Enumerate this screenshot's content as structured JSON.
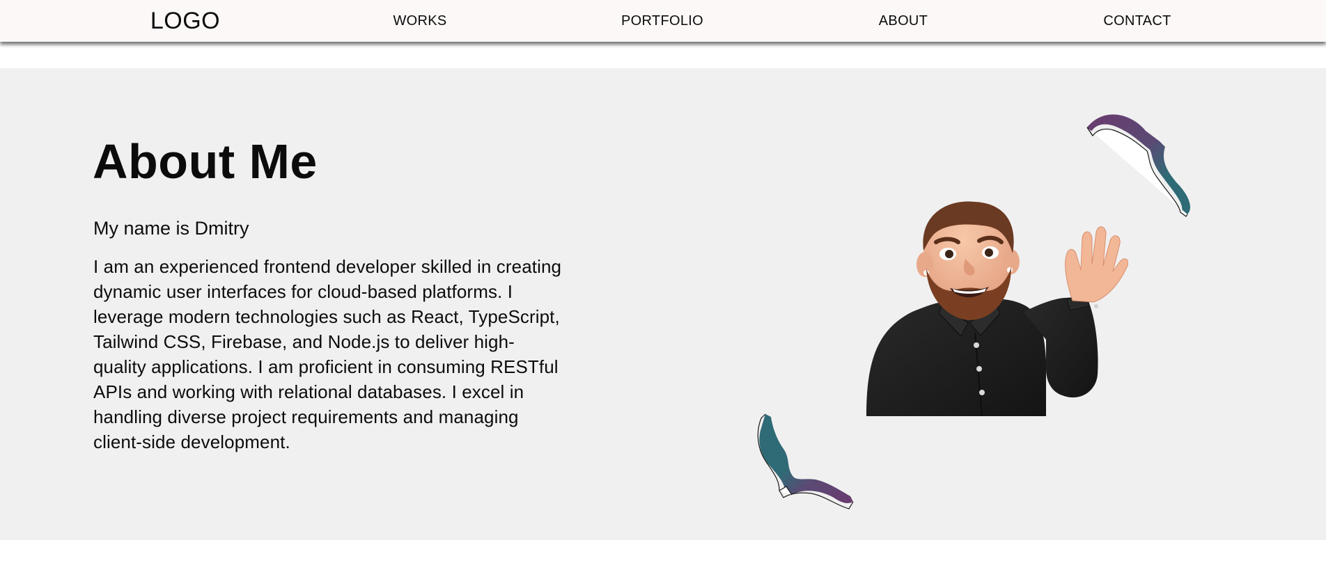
{
  "navbar": {
    "logo": "LOGO",
    "links": [
      "WORKS",
      "PORTFOLIO",
      "ABOUT",
      "CONTACT"
    ]
  },
  "about": {
    "title": "About Me",
    "name_line": "My name is Dmitry",
    "bio": "I am an experienced frontend developer skilled in creating dynamic user interfaces for cloud-based platforms. I leverage modern technologies such as React, TypeScript, Tailwind CSS, Firebase, and Node.js to deliver high-quality applications. I am proficient in consuming RESTful APIs and working with relational databases. I excel in handling diverse project requirements and managing client-side development."
  },
  "images": {
    "avatar": "memoji-avatar-waving",
    "decoration_top": "ribbon-decoration-icon",
    "decoration_bottom": "ribbon-decoration-icon"
  },
  "colors": {
    "navbar_bg": "#fbf8f7",
    "section_bg": "#f0f0f0",
    "ribbon_purple": "#5e3a6e",
    "ribbon_teal": "#2f6b76",
    "shirt": "#1d1d1d",
    "skin": "#f0b596",
    "hair": "#6b3a22"
  }
}
